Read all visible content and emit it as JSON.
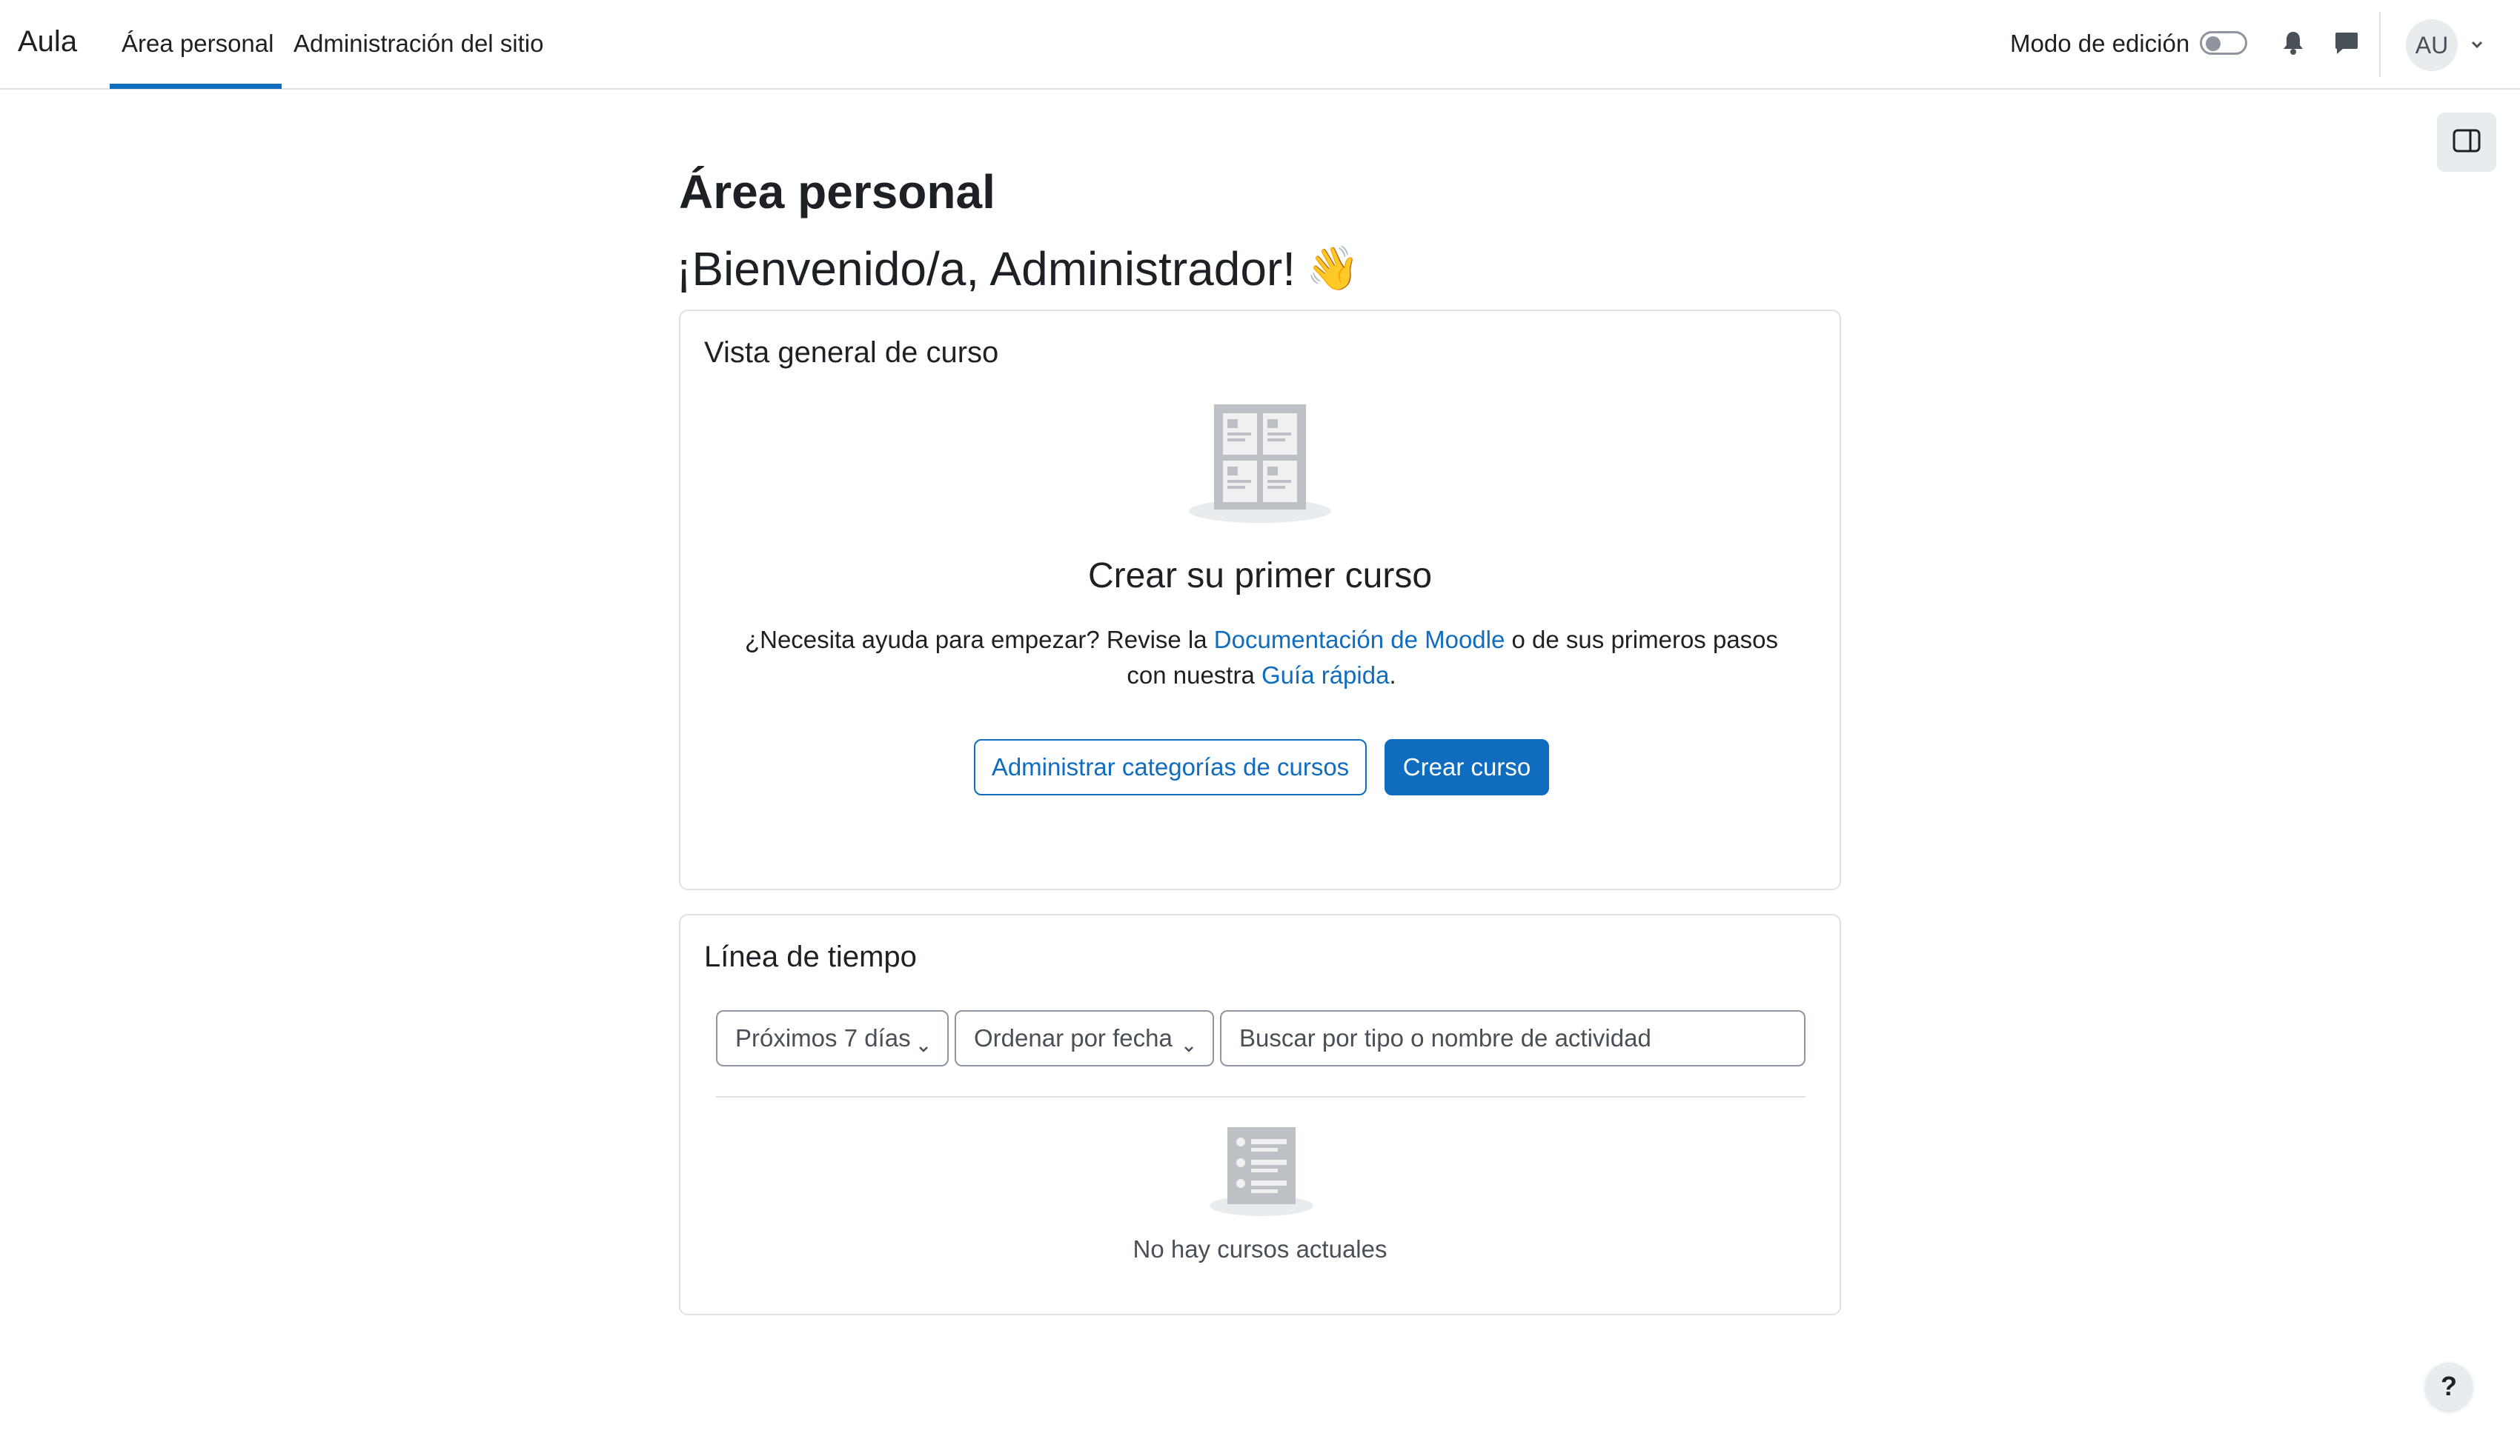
{
  "navbar": {
    "brand": "Aula",
    "items": [
      {
        "label": "Área personal",
        "active": true
      },
      {
        "label": "Administración del sitio",
        "active": false
      }
    ],
    "edit_mode_label": "Modo de edición",
    "edit_mode_on": false,
    "avatar_initials": "AU",
    "accent_color": "#0f6cbf"
  },
  "page": {
    "title": "Área personal",
    "welcome": "¡Bienvenido/a, Administrador!",
    "welcome_emoji": "👋"
  },
  "course_overview": {
    "title": "Vista general de curso",
    "heading": "Crear su primer curso",
    "text_before": "¿Necesita ayuda para empezar? Revise la ",
    "docs_link": "Documentación de Moodle",
    "text_middle": " o de sus primeros pasos con nuestra ",
    "guide_link": "Guía rápida",
    "text_after": ".",
    "manage_button": "Administrar categorías de cursos",
    "create_button": "Crear curso"
  },
  "timeline": {
    "title": "Línea de tiempo",
    "filter_selected": "Próximos 7 días",
    "sort_selected": "Ordenar por fecha",
    "search_placeholder": "Buscar por tipo o nombre de actividad",
    "empty_text": "No hay cursos actuales"
  },
  "help": {
    "label": "?"
  }
}
